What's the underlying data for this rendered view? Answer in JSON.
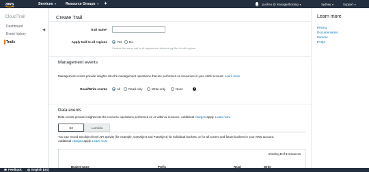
{
  "topnav": {
    "logo_text": "aws",
    "services_label": "Services",
    "resource_groups_label": "Resource Groups",
    "account_label": "pucheo @ managedhosting",
    "region_label": "Sydney",
    "support_label": "Support"
  },
  "sidebar": {
    "brand": "CloudTrail",
    "collapse_glyph": "◀",
    "items": [
      {
        "label": "Dashboard"
      },
      {
        "label": "Event history"
      },
      {
        "label": "Trails"
      }
    ]
  },
  "main": {
    "title": "Create Trail",
    "trail_name_label": "Trail name*",
    "trail_name_value": "",
    "apply_label": "Apply trail to all regions",
    "apply_yes": "Yes",
    "apply_no": "No",
    "apply_help": "Creates the same trail in all regions and delivers log files for all regions.",
    "management_events": {
      "title": "Management events",
      "desc": "Management events provide insights into the management operations that are performed on resources in your AWS account.",
      "learn_more": "Learn more",
      "rw_label": "Read/Write events",
      "options": [
        "All",
        "Read-only",
        "Write-only",
        "None"
      ],
      "selected": "All",
      "info_glyph": "i"
    },
    "data_events": {
      "title": "Data events",
      "desc_prefix": "Data events provide insights into the resource operations performed on or within a resource. Additional",
      "charges_link": "charges",
      "desc_suffix": "apply.",
      "learn_more": "Learn more",
      "tabs": [
        "S3",
        "Lambda"
      ],
      "s3_desc_line1": "You can record S3 object-level API activity (for example, GetObject and PutObject) for individual buckets, or for all current and future buckets in your AWS account.",
      "s3_desc_line2_prefix": "Additional",
      "s3_charges_link": "charges",
      "s3_desc_line2_suffix": "apply.",
      "s3_learn_more": "Learn more",
      "showing_prefix": "Showing",
      "showing_count": "0",
      "showing_mid": "of",
      "showing_total": "0",
      "showing_suffix": "resources",
      "columns": [
        "Bucket name",
        "Prefix",
        "Read",
        "Write"
      ]
    }
  },
  "help": {
    "title": "Learn more",
    "links": [
      "Pricing",
      "Documentation",
      "Forums",
      "FAQs"
    ]
  },
  "footer": {
    "feedback_label": "Feedback",
    "language_label": "English (US)"
  },
  "colors": {
    "nav_bg": "#232f3e",
    "accent_orange": "#ec7211",
    "link_blue": "#0073bb",
    "page_bg": "#f2f3f3"
  }
}
